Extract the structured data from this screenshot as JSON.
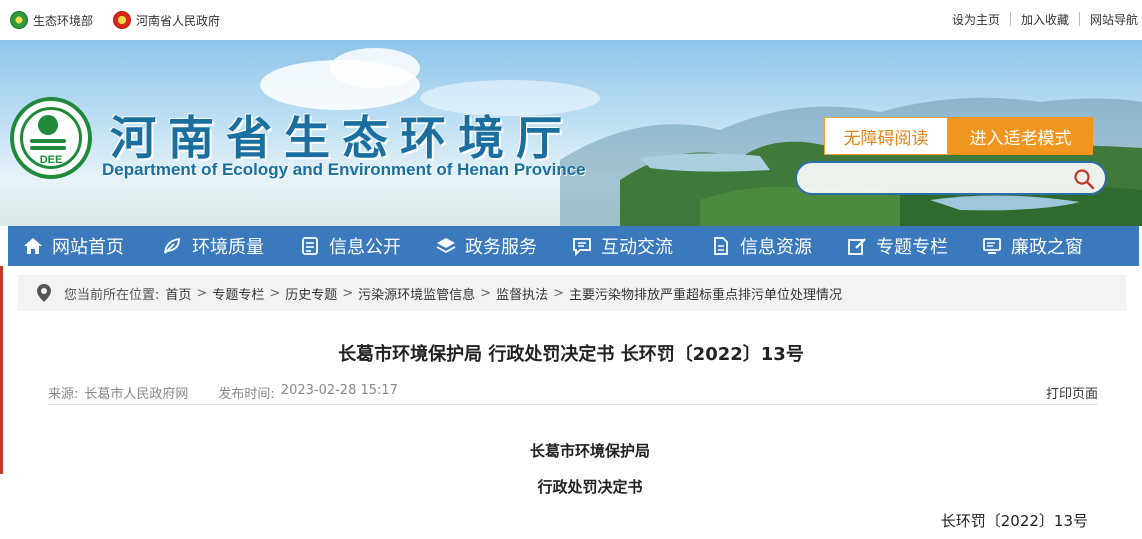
{
  "topbar": {
    "left_links": [
      {
        "label": "生态环境部",
        "icon": "ministry-emblem-icon"
      },
      {
        "label": "河南省人民政府",
        "icon": "national-emblem-icon"
      }
    ],
    "right_links": [
      "设为主页",
      "加入收藏",
      "网站导航"
    ]
  },
  "header": {
    "title": "河南省生态环境厅",
    "subtitle": "Department of Ecology and Environment of Henan Province",
    "logo_text": "DEE",
    "accessible_reading": "无障碍阅读",
    "elder_mode": "进入适老模式",
    "search_placeholder": "",
    "colors": {
      "title": "#1a6f9e",
      "accent": "#f0961e",
      "nav": "#3b79bd"
    }
  },
  "nav": [
    {
      "label": "网站首页",
      "icon": "home-icon"
    },
    {
      "label": "环境质量",
      "icon": "leaf-icon"
    },
    {
      "label": "信息公开",
      "icon": "document-icon"
    },
    {
      "label": "政务服务",
      "icon": "layers-icon"
    },
    {
      "label": "互动交流",
      "icon": "chat-icon"
    },
    {
      "label": "信息资源",
      "icon": "file-icon"
    },
    {
      "label": "专题专栏",
      "icon": "edit-icon"
    },
    {
      "label": "廉政之窗",
      "icon": "monitor-icon"
    }
  ],
  "breadcrumb": {
    "prefix": "您当前所在位置:",
    "items": [
      "首页",
      "专题专栏",
      "历史专题",
      "污染源环境监管信息",
      "监督执法",
      "主要污染物排放严重超标重点排污单位处理情况"
    ]
  },
  "article": {
    "title": "长葛市环境保护局 行政处罚决定书 长环罚〔2022〕13号",
    "source_label": "来源:",
    "source": "长葛市人民政府网",
    "date_label": "发布时间:",
    "date": "2023-02-28 15:17",
    "print": "打印页面",
    "org": "长葛市环境保护局",
    "doc_type": "行政处罚决定书",
    "doc_no": "长环罚〔2022〕13号"
  }
}
